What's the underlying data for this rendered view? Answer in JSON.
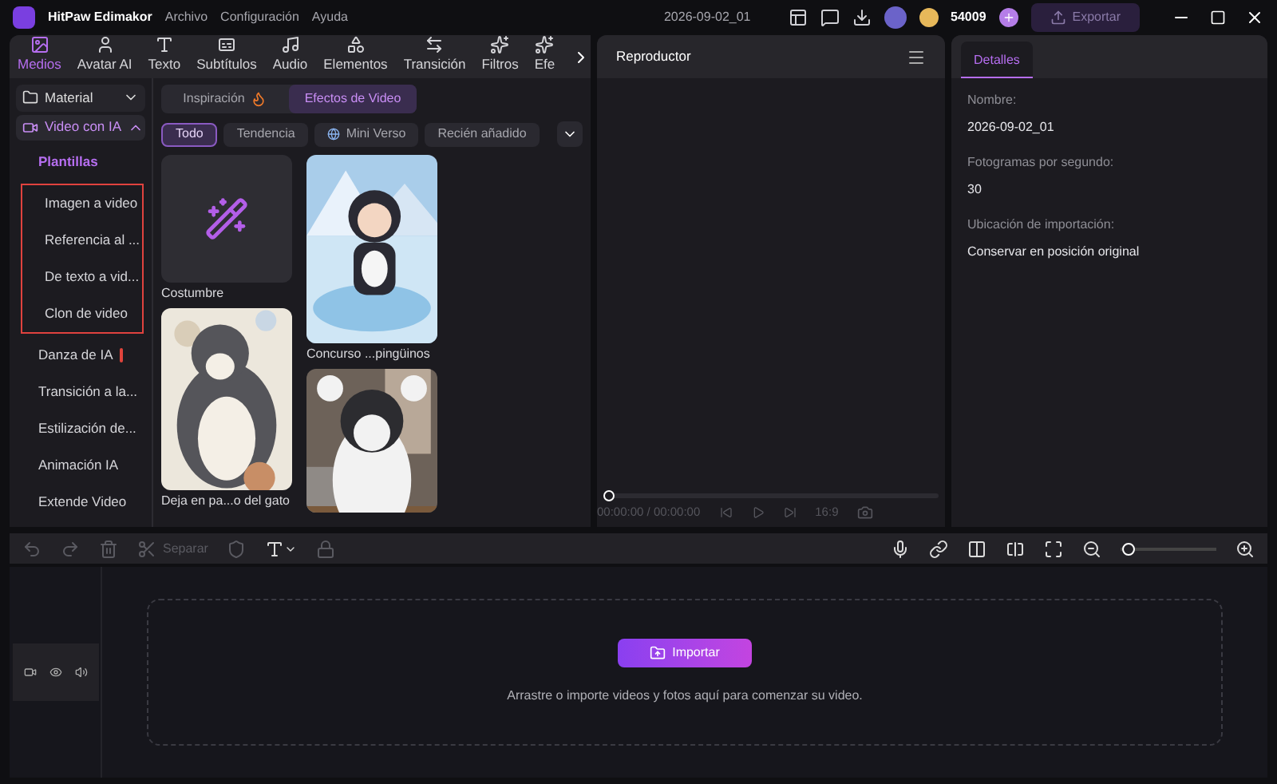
{
  "titlebar": {
    "app_name": "HitPaw Edimakor",
    "menus": [
      "Archivo",
      "Configuración",
      "Ayuda"
    ],
    "project_title": "2026-09-02_01",
    "coins": "54009",
    "export_label": "Exportar"
  },
  "tabs": [
    {
      "label": "Medios",
      "selected": true
    },
    {
      "label": "Avatar AI",
      "selected": false
    },
    {
      "label": "Texto",
      "selected": false
    },
    {
      "label": "Subtítulos",
      "selected": false
    },
    {
      "label": "Audio",
      "selected": false
    },
    {
      "label": "Elementos",
      "selected": false
    },
    {
      "label": "Transición",
      "selected": false
    },
    {
      "label": "Filtros",
      "selected": false
    },
    {
      "label": "Efe",
      "selected": false
    }
  ],
  "sidebar": {
    "sections": [
      {
        "label": "Material",
        "expanded": false
      },
      {
        "label": "Video con IA",
        "expanded": true
      }
    ],
    "items": [
      {
        "label": "Plantillas",
        "selected": true,
        "outlined": false
      },
      {
        "label": "Imagen a video",
        "selected": false,
        "outlined": true
      },
      {
        "label": "Referencia al ...",
        "selected": false,
        "outlined": true
      },
      {
        "label": "De texto a vid...",
        "selected": false,
        "outlined": true
      },
      {
        "label": "Clon de video",
        "selected": false,
        "outlined": true
      },
      {
        "label": "Danza de IA",
        "selected": false,
        "outlined": false,
        "badge": true
      },
      {
        "label": "Transición a la...",
        "selected": false,
        "outlined": false
      },
      {
        "label": "Estilización de...",
        "selected": false,
        "outlined": false
      },
      {
        "label": "Animación IA",
        "selected": false,
        "outlined": false
      },
      {
        "label": "Extende Video",
        "selected": false,
        "outlined": false
      }
    ]
  },
  "segments": [
    {
      "label": "Inspiración",
      "selected": false
    },
    {
      "label": "Efectos de Video",
      "selected": true
    }
  ],
  "filters": [
    {
      "label": "Todo",
      "selected": true
    },
    {
      "label": "Tendencia",
      "selected": false
    },
    {
      "label": "Mini Verso",
      "selected": false
    },
    {
      "label": "Recién añadido",
      "selected": false
    }
  ],
  "cards": [
    {
      "kind": "custom",
      "title": "Costumbre"
    },
    {
      "kind": "picture",
      "title": "Concurso ...pingüinos"
    },
    {
      "kind": "picture",
      "title": "Deja en pa...o del gato"
    },
    {
      "kind": "picture"
    }
  ],
  "player": {
    "title": "Reproductor",
    "level": 0,
    "time": "00:00:00 / 00:00:00",
    "ratio": "16:9"
  },
  "details": {
    "tab": "Detalles",
    "fields": [
      {
        "label": "Nombre:",
        "value": "2026-09-02_01"
      },
      {
        "label": "Fotogramas por segundo:",
        "value": "30"
      },
      {
        "label": "Ubicación de importación:",
        "value": "Conservar en posición original"
      }
    ]
  },
  "timeline": {
    "split_label": "Separar",
    "zoom": {
      "level": 0.02
    },
    "import_label": "Importar",
    "hint": "Arrastre o importe videos y fotos aquí para comenzar su video."
  }
}
